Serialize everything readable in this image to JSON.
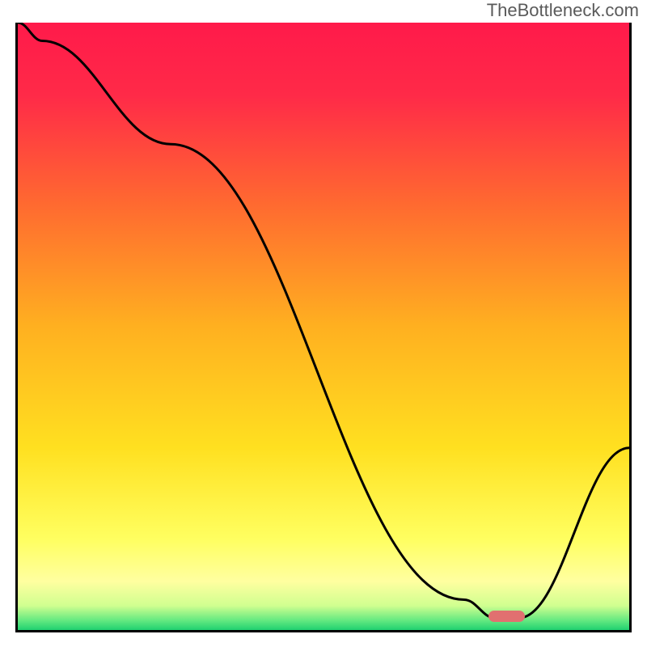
{
  "watermark": "TheBottleneck.com",
  "chart_data": {
    "type": "line",
    "title": "",
    "xlabel": "",
    "ylabel": "",
    "xlim": [
      0,
      100
    ],
    "ylim": [
      0,
      100
    ],
    "x": [
      0,
      4,
      25,
      73,
      78,
      82,
      100
    ],
    "values": [
      100,
      97,
      80,
      5,
      2,
      2,
      30
    ],
    "gradient_stops": [
      {
        "pos": 0.0,
        "color": "#ff1a4a"
      },
      {
        "pos": 0.12,
        "color": "#ff2a48"
      },
      {
        "pos": 0.3,
        "color": "#ff6a30"
      },
      {
        "pos": 0.5,
        "color": "#ffb020"
      },
      {
        "pos": 0.7,
        "color": "#ffe020"
      },
      {
        "pos": 0.85,
        "color": "#ffff60"
      },
      {
        "pos": 0.92,
        "color": "#ffffa0"
      },
      {
        "pos": 0.96,
        "color": "#d0ff90"
      },
      {
        "pos": 0.985,
        "color": "#60e880"
      },
      {
        "pos": 1.0,
        "color": "#20d070"
      }
    ],
    "marker": {
      "x_start": 77,
      "x_end": 83,
      "y": 2.2,
      "color": "#e17070"
    }
  }
}
